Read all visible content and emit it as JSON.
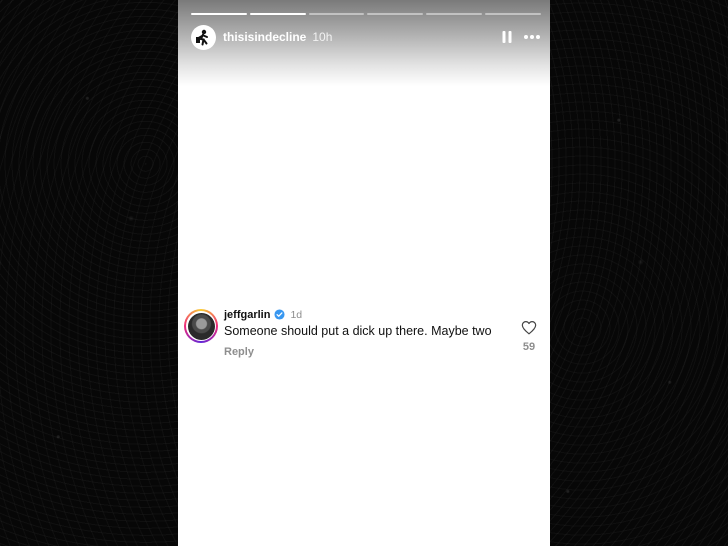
{
  "story": {
    "progress_segments": 6,
    "progress_completed": 2,
    "owner": {
      "username": "thisisindecline",
      "time_ago": "10h"
    },
    "controls": {
      "pause_icon": "pause-icon",
      "more_icon": "more-options-icon"
    }
  },
  "comment": {
    "username": "jeffgarlin",
    "verified": true,
    "age": "1d",
    "text": "Someone should put a dick up there. Maybe two",
    "reply_label": "Reply",
    "like_icon": "heart-outline-icon",
    "like_count": "59"
  },
  "colors": {
    "backdrop": "#060606",
    "panel": "#ffffff",
    "verified_blue": "#3897f0",
    "muted_text": "#8e8e8e"
  }
}
